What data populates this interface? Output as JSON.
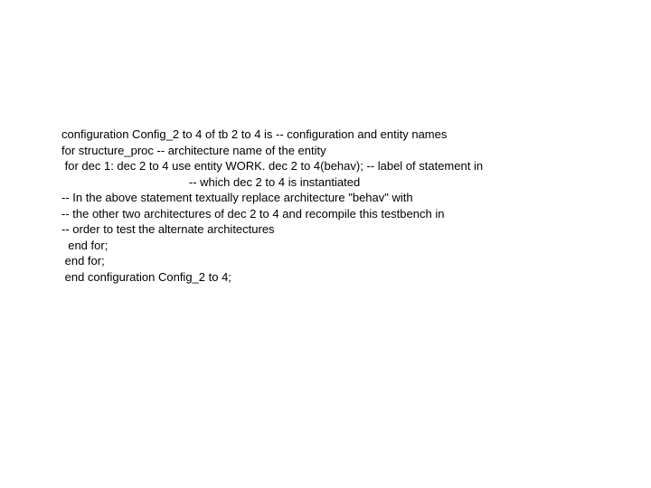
{
  "code": {
    "line1": "configuration Config_2 to 4 of tb 2 to 4 is -- configuration and entity names",
    "line2": "for structure_proc -- architecture name of the entity",
    "line3": " for dec 1: dec 2 to 4 use entity WORK. dec 2 to 4(behav); -- label of statement in",
    "line4": "                                       -- which dec 2 to 4 is instantiated",
    "line5": "-- In the above statement textually replace architecture \"behav\" with",
    "line6": "-- the other two architectures of dec 2 to 4 and recompile this testbench in",
    "line7": "-- order to test the alternate architectures",
    "line8": "",
    "line9": "  end for;",
    "line10": " end for;",
    "line11": " end configuration Config_2 to 4;"
  }
}
